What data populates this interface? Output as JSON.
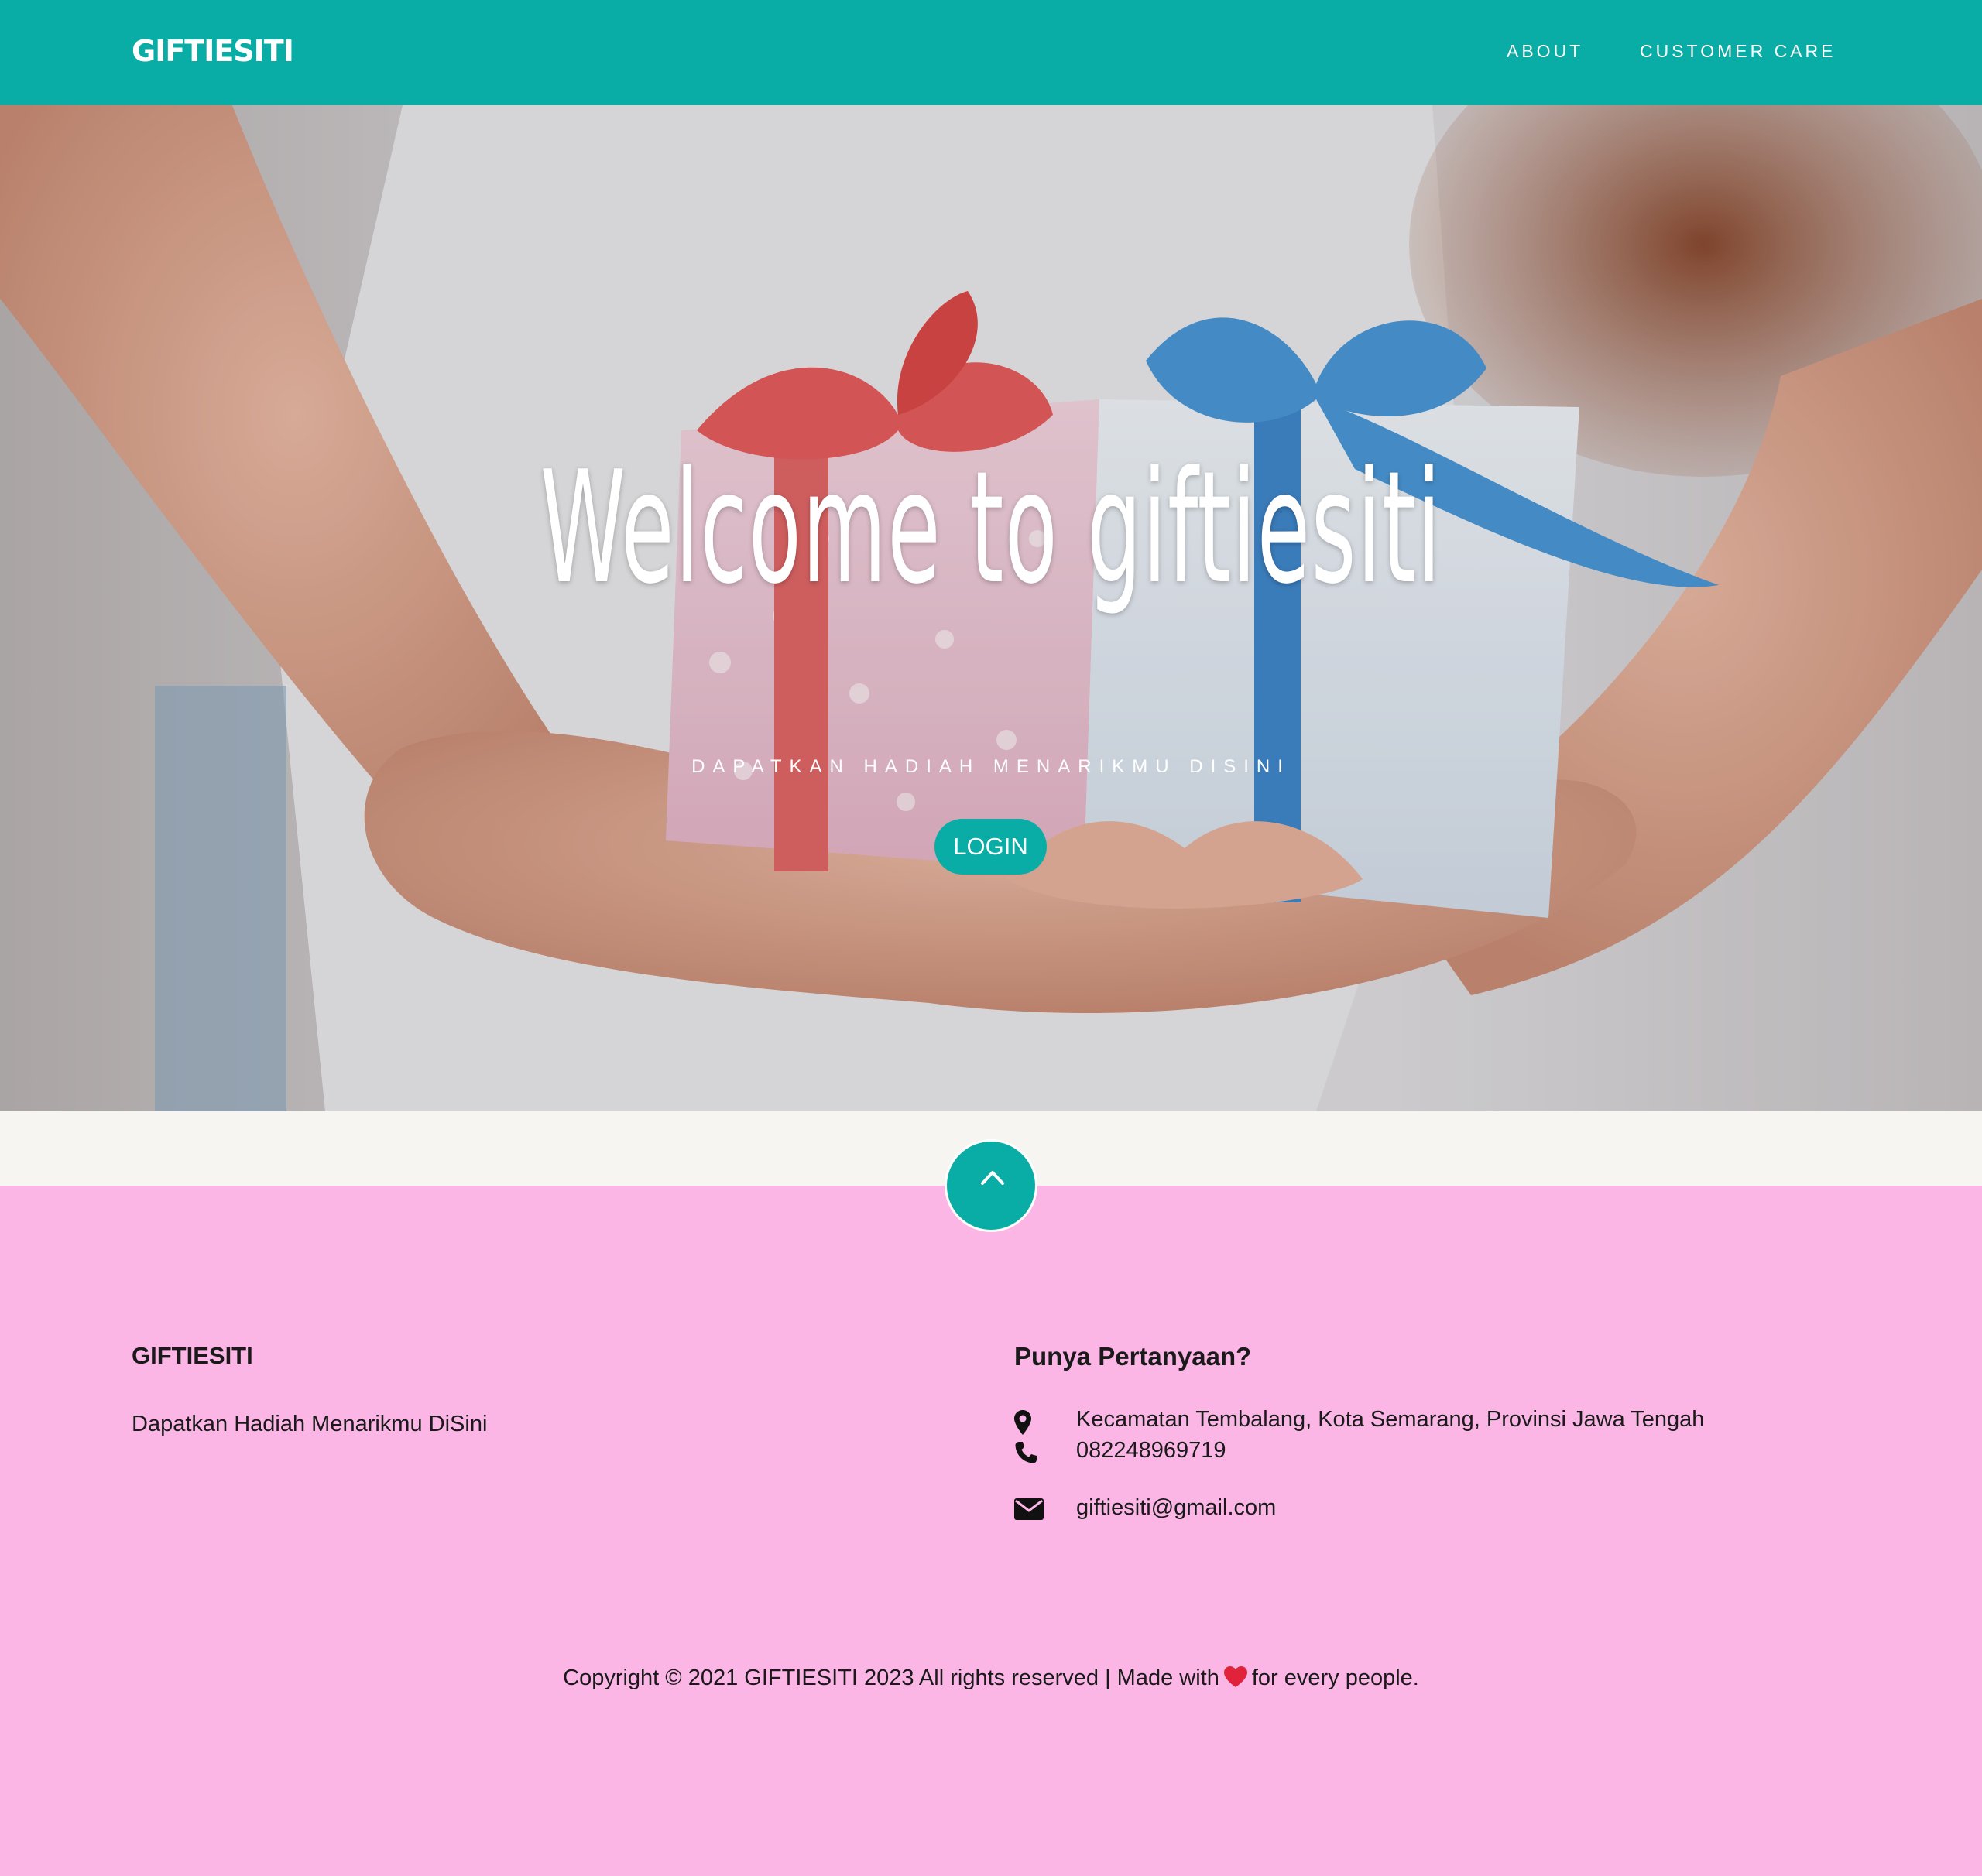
{
  "nav": {
    "brand": "GIFTIESITI",
    "links": [
      {
        "label": "ABOUT"
      },
      {
        "label": "CUSTOMER CARE"
      }
    ]
  },
  "hero": {
    "title": "Welcome to giftiesiti",
    "subtitle": "DAPATKAN HADIAH MENARIKMU DISINI",
    "login_label": "LOGIN"
  },
  "footer": {
    "brand": "GIFTIESITI",
    "tagline": "Dapatkan Hadiah Menarikmu DiSini",
    "question_title": "Punya Pertanyaan?",
    "contacts": {
      "address": "Kecamatan Tembalang, Kota Semarang, Provinsi Jawa Tengah",
      "phone": "082248969719",
      "email": "giftiesiti@gmail.com"
    },
    "copyright_before": "Copyright © 2021 GIFTIESITI 2023 All rights reserved | Made with",
    "copyright_after": "for every people."
  },
  "icons": {
    "location": "map-marker-icon",
    "phone": "phone-icon",
    "email": "envelope-icon",
    "heart": "heart-icon",
    "scroll_top": "chevron-up-icon"
  },
  "colors": {
    "primary": "#0aada6",
    "footer_bg": "#fbb6e6",
    "strip_bg": "#f7f5f2",
    "heart": "#e0223b"
  }
}
